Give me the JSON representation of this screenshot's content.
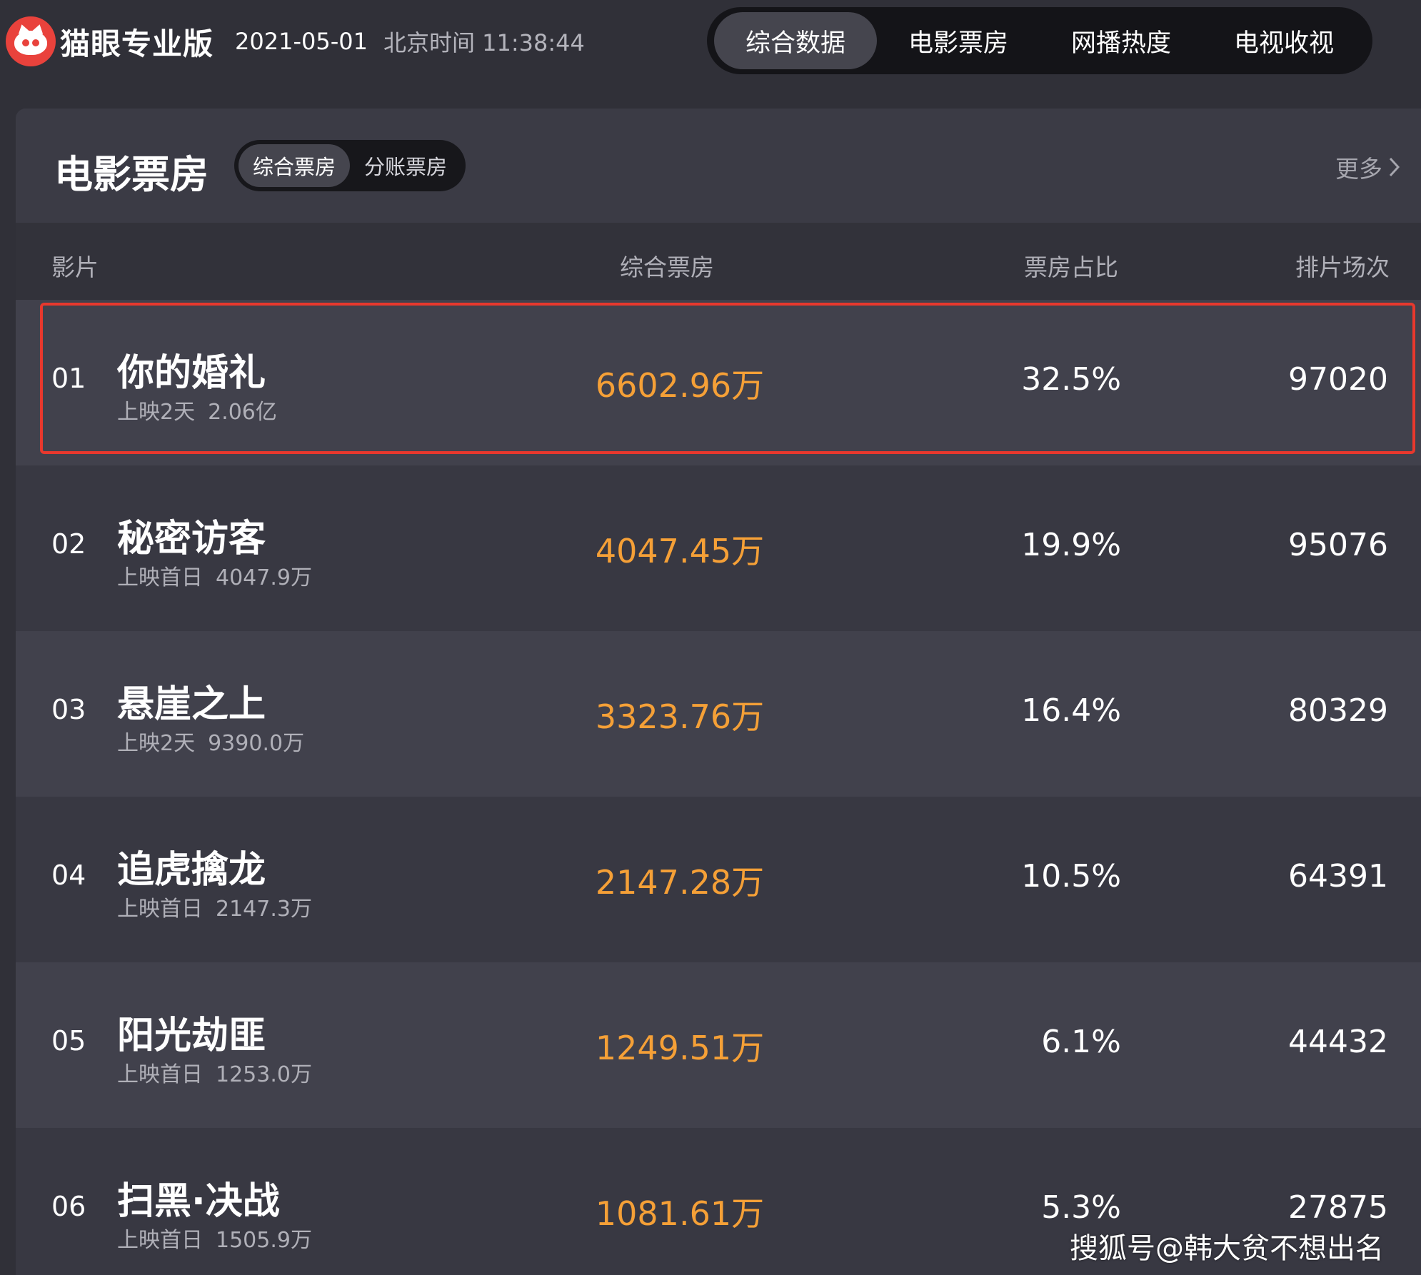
{
  "header": {
    "brand_name": "猫眼专业版",
    "date": "2021-05-01",
    "time_label": "北京时间 11:38:44",
    "nav_tabs": [
      {
        "label": "综合数据",
        "active": true
      },
      {
        "label": "电影票房",
        "active": false
      },
      {
        "label": "网播热度",
        "active": false
      },
      {
        "label": "电视收视",
        "active": false
      }
    ]
  },
  "panel": {
    "title": "电影票房",
    "segments": [
      {
        "label": "综合票房",
        "active": true
      },
      {
        "label": "分账票房",
        "active": false
      }
    ],
    "more_label": "更多",
    "columns": {
      "film": "影片",
      "box_office": "综合票房",
      "share": "票房占比",
      "shows": "排片场次"
    },
    "rows": [
      {
        "rank": "01",
        "name": "你的婚礼",
        "sub_label": "上映2天",
        "sub_value": "2.06亿",
        "box_office": "6602.96万",
        "share": "32.5%",
        "shows": "97020",
        "highlighted": true
      },
      {
        "rank": "02",
        "name": "秘密访客",
        "sub_label": "上映首日",
        "sub_value": "4047.9万",
        "box_office": "4047.45万",
        "share": "19.9%",
        "shows": "95076"
      },
      {
        "rank": "03",
        "name": "悬崖之上",
        "sub_label": "上映2天",
        "sub_value": "9390.0万",
        "box_office": "3323.76万",
        "share": "16.4%",
        "shows": "80329"
      },
      {
        "rank": "04",
        "name": "追虎擒龙",
        "sub_label": "上映首日",
        "sub_value": "2147.3万",
        "box_office": "2147.28万",
        "share": "10.5%",
        "shows": "64391"
      },
      {
        "rank": "05",
        "name": "阳光劫匪",
        "sub_label": "上映首日",
        "sub_value": "1253.0万",
        "box_office": "1249.51万",
        "share": "6.1%",
        "shows": "44432"
      },
      {
        "rank": "06",
        "name": "扫黑·决战",
        "sub_label": "上映首日",
        "sub_value": "1505.9万",
        "box_office": "1081.61万",
        "share": "5.3%",
        "shows": "27875"
      }
    ]
  },
  "watermark": "搜狐号@韩大贫不想出名",
  "colors": {
    "accent_orange": "#f5a037",
    "highlight_red": "#e8382d",
    "brand_red": "#e9423c"
  },
  "icons": {
    "logo": "cat-logo-icon",
    "more": "chevron-right-icon"
  }
}
